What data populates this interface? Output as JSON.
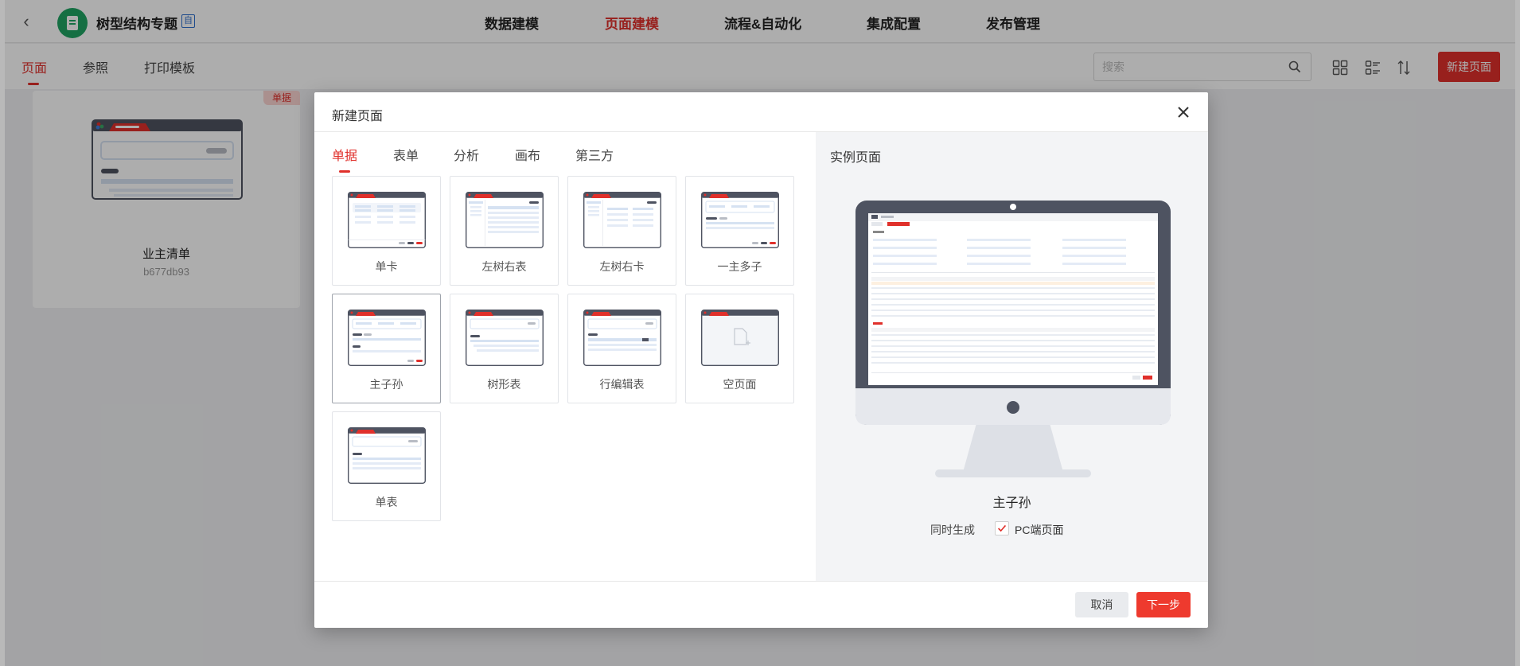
{
  "app": {
    "title": "树型结构专题",
    "badge": "自",
    "nav": [
      "数据建模",
      "页面建模",
      "流程&自动化",
      "集成配置",
      "发布管理"
    ],
    "active_nav": "页面建模"
  },
  "subnav": {
    "tabs": [
      "页面",
      "参照",
      "打印模板"
    ],
    "active": "页面",
    "search_placeholder": "搜索",
    "new_button": "新建页面"
  },
  "card": {
    "tag": "单据",
    "name": "业主清单",
    "code": "b677db93"
  },
  "modal": {
    "title": "新建页面",
    "tabs": [
      "单据",
      "表单",
      "分析",
      "画布",
      "第三方"
    ],
    "active_tab": "单据",
    "templates": [
      {
        "label": "单卡",
        "icon": "single-card-template-icon"
      },
      {
        "label": "左树右表",
        "icon": "tree-table-template-icon"
      },
      {
        "label": "左树右卡",
        "icon": "tree-card-template-icon"
      },
      {
        "label": "一主多子",
        "icon": "master-multi-detail-template-icon"
      },
      {
        "label": "主子孙",
        "icon": "master-child-grandchild-template-icon"
      },
      {
        "label": "树形表",
        "icon": "tree-grid-template-icon"
      },
      {
        "label": "行编辑表",
        "icon": "inline-edit-table-template-icon"
      },
      {
        "label": "空页面",
        "icon": "blank-page-template-icon"
      },
      {
        "label": "单表",
        "icon": "single-table-template-icon"
      }
    ],
    "selected_template": "主子孙",
    "preview": {
      "title": "实例页面",
      "name": "主子孙",
      "generate_label": "同时生成",
      "generate_option": "PC端页面",
      "generate_checked": true
    },
    "cancel": "取消",
    "next": "下一步"
  },
  "colors": {
    "accent": "#e0302b",
    "logo": "#1fa463",
    "thumb_header": "#4e5361",
    "thumb_line": "#d6e2f2"
  }
}
